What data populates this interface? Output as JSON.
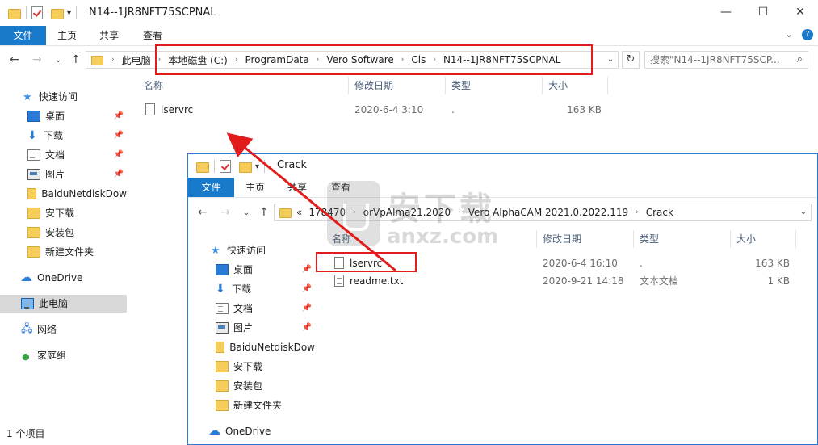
{
  "back_window": {
    "title": "N14--1JR8NFT75SCPNAL",
    "controls": {
      "minimize": "—",
      "maximize": "☐",
      "close": "✕"
    },
    "ribbon": {
      "tabs": [
        "文件",
        "主页",
        "共享",
        "查看"
      ],
      "expand": "⌄",
      "help": "?"
    },
    "address": [
      "此电脑",
      "本地磁盘 (C:)",
      "ProgramData",
      "Vero Software",
      "Cls",
      "N14--1JR8NFT75SCPNAL"
    ],
    "search_placeholder": "搜索\"N14--1JR8NFT75SCP...",
    "nav_items": [
      {
        "label": "快速访问",
        "icon": "star-icon"
      },
      {
        "label": "桌面",
        "icon": "desktop-icon",
        "pinned": true
      },
      {
        "label": "下载",
        "icon": "download-icon",
        "pinned": true
      },
      {
        "label": "文档",
        "icon": "document-icon",
        "pinned": true
      },
      {
        "label": "图片",
        "icon": "pictures-icon",
        "pinned": true
      },
      {
        "label": "BaiduNetdiskDow",
        "icon": "folder-icon"
      },
      {
        "label": "安下载",
        "icon": "folder-icon"
      },
      {
        "label": "安装包",
        "icon": "folder-icon"
      },
      {
        "label": "新建文件夹",
        "icon": "folder-icon"
      },
      {
        "label": "OneDrive",
        "icon": "onedrive-icon"
      },
      {
        "label": "此电脑",
        "icon": "pc-icon",
        "selected": true
      },
      {
        "label": "网络",
        "icon": "network-icon"
      },
      {
        "label": "家庭组",
        "icon": "homegroup-icon"
      }
    ],
    "columns": [
      "名称",
      "修改日期",
      "类型",
      "大小"
    ],
    "files": [
      {
        "name": "lservrc",
        "date": "2020-6-4 3:10",
        "type": ".",
        "size": "163 KB"
      }
    ],
    "status": "1 个项目"
  },
  "front_window": {
    "title": "Crack",
    "ribbon": {
      "tabs": [
        "文件",
        "主页",
        "共享",
        "查看"
      ]
    },
    "address": [
      "«",
      "178470",
      "orVpAlma21.2020",
      "Vero AlphaCAM 2021.0.2022.119",
      "Crack"
    ],
    "nav_items": [
      {
        "label": "快速访问",
        "icon": "star-icon"
      },
      {
        "label": "桌面",
        "icon": "desktop-icon",
        "pinned": true
      },
      {
        "label": "下载",
        "icon": "download-icon",
        "pinned": true
      },
      {
        "label": "文档",
        "icon": "document-icon",
        "pinned": true
      },
      {
        "label": "图片",
        "icon": "pictures-icon",
        "pinned": true
      },
      {
        "label": "BaiduNetdiskDow",
        "icon": "folder-icon"
      },
      {
        "label": "安下载",
        "icon": "folder-icon"
      },
      {
        "label": "安装包",
        "icon": "folder-icon"
      },
      {
        "label": "新建文件夹",
        "icon": "folder-icon"
      },
      {
        "label": "OneDrive",
        "icon": "onedrive-icon"
      }
    ],
    "columns": [
      "名称",
      "修改日期",
      "类型",
      "大小"
    ],
    "files": [
      {
        "name": "lservrc",
        "date": "2020-6-4 16:10",
        "type": ".",
        "size": "163 KB"
      },
      {
        "name": "readme.txt",
        "date": "2020-9-21 14:18",
        "type": "文本文档",
        "size": "1 KB"
      }
    ]
  },
  "watermark": {
    "text_cn": "安下载",
    "text_en": "anxz.com"
  },
  "colors": {
    "accent": "#1979ca",
    "highlight": "#e21b1b",
    "selected_bg": "#d9d9d9"
  }
}
